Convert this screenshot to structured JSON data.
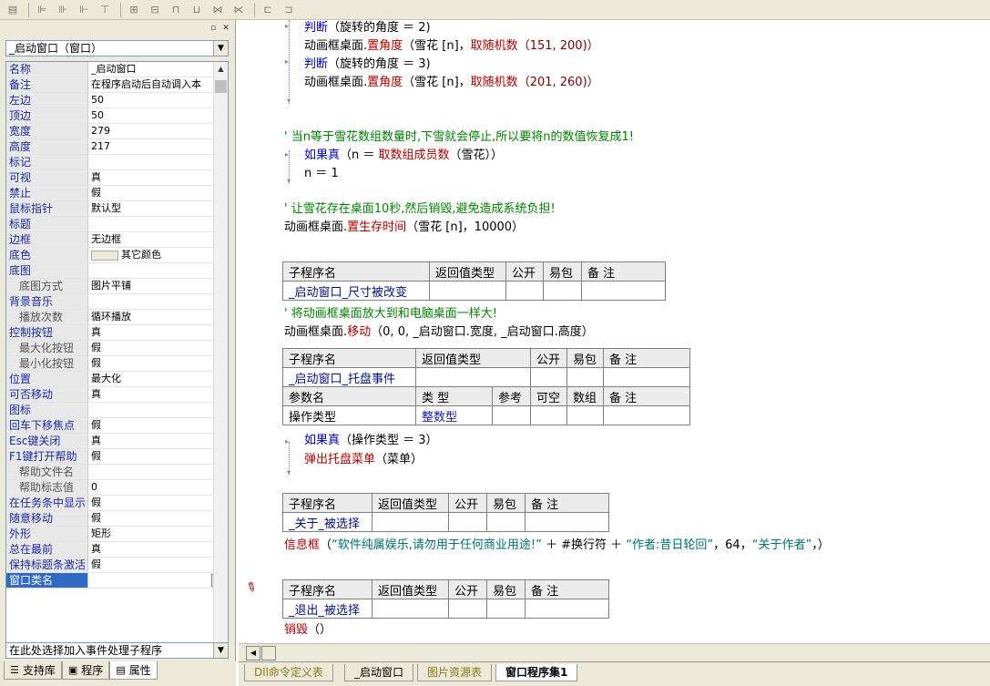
{
  "toolbar": {
    "buttons": [
      "properties-icon",
      "align-left-icon",
      "align-center-icon",
      "align-right-icon",
      "align-top-icon",
      "align-middle-icon",
      "align-bottom-icon",
      "same-width-icon",
      "same-height-icon",
      "same-size-icon",
      "space-h-icon",
      "space-v-icon",
      "center-h-icon",
      "center-v-icon"
    ]
  },
  "left_panel": {
    "object_select": "_启动窗口（窗口）",
    "properties": [
      {
        "name": "名称",
        "value": "_启动窗口"
      },
      {
        "name": "备注",
        "value": "在程序启动后自动调入本"
      },
      {
        "name": "左边",
        "value": "50"
      },
      {
        "name": "顶边",
        "value": "50"
      },
      {
        "name": "宽度",
        "value": "279"
      },
      {
        "name": "高度",
        "value": "217"
      },
      {
        "name": "标记",
        "value": ""
      },
      {
        "name": "可视",
        "value": "真"
      },
      {
        "name": "禁止",
        "value": "假"
      },
      {
        "name": "鼠标指针",
        "value": "默认型"
      },
      {
        "name": "标题",
        "value": ""
      },
      {
        "name": "边框",
        "value": "无边框"
      },
      {
        "name": "底色",
        "value": "其它颜色"
      },
      {
        "name": "底图",
        "value": ""
      },
      {
        "name": "底图方式",
        "value": "图片平铺",
        "sub": true
      },
      {
        "name": "背景音乐",
        "value": ""
      },
      {
        "name": "播放次数",
        "value": "循环播放",
        "sub": true
      },
      {
        "name": "控制按钮",
        "value": "真"
      },
      {
        "name": "最大化按钮",
        "value": "假",
        "sub": true
      },
      {
        "name": "最小化按钮",
        "value": "假",
        "sub": true
      },
      {
        "name": "位置",
        "value": "最大化"
      },
      {
        "name": "可否移动",
        "value": "真"
      },
      {
        "name": "图标",
        "value": ""
      },
      {
        "name": "回车下移焦点",
        "value": "假"
      },
      {
        "name": "Esc键关闭",
        "value": "真"
      },
      {
        "name": "F1键打开帮助",
        "value": "假"
      },
      {
        "name": "帮助文件名",
        "value": "",
        "sub": true
      },
      {
        "name": "帮助标志值",
        "value": "0",
        "sub": true
      },
      {
        "name": "在任务条中显示",
        "value": "假"
      },
      {
        "name": "随意移动",
        "value": "假"
      },
      {
        "name": "外形",
        "value": "矩形"
      },
      {
        "name": "总在最前",
        "value": "真"
      },
      {
        "name": "保持标题条激活",
        "value": "假"
      },
      {
        "name": "窗口类名",
        "value": "",
        "selected": true
      }
    ],
    "event_select": "在此处选择加入事件处理子程序",
    "tabs": [
      {
        "label": "支持库"
      },
      {
        "label": "程序"
      },
      {
        "label": "属性"
      }
    ]
  },
  "code": {
    "l1_kw": "判断",
    "l1_rest": "（旋转的角度 ＝ 2)",
    "l2_obj": "动画框桌面.",
    "l2_fn": "置角度",
    "l2_a": "（雪花 [n]，",
    "l2_fn2": "取随机数",
    "l2_b": "（151, 200)）",
    "l3_kw": "判断",
    "l3_rest": "（旋转的角度 ＝ 3)",
    "l4_obj": "动画框桌面.",
    "l4_fn": "置角度",
    "l4_a": "（雪花 [n]，",
    "l4_fn2": "取随机数",
    "l4_b": "（201, 260)）",
    "c1": "' 当n等于雪花数组数量时,下雪就会停止,所以要将n的数值恢复成1!",
    "if1_kw": "如果真",
    "if1_a": "（n ＝ ",
    "if1_fn": "取数组成员数",
    "if1_b": "（雪花））",
    "assign": "n ＝ 1",
    "c2": "' 让雪花存在桌面10秒,然后销毁,避免造成系统负担!",
    "l5_obj": "动画框桌面.",
    "l5_fn": "置生存时间",
    "l5_a": "（雪花 [n]，10000）",
    "t1": {
      "headers": [
        "子程序名",
        "返回值类型",
        "公开",
        "易包",
        "备 注"
      ],
      "name": "_启动窗口_尺寸被改变"
    },
    "c3": "' 将动画框桌面放大到和电脑桌面一样大!",
    "l6_obj": "动画框桌面.",
    "l6_fn": "移动",
    "l6_a": "（0, 0, _启动窗口.宽度, _启动窗口.高度）",
    "t2": {
      "headers": [
        "子程序名",
        "返回值类型",
        "公开",
        "易包",
        "备 注"
      ],
      "name": "_启动窗口_托盘事件",
      "param_headers": [
        "参数名",
        "类 型",
        "参考",
        "可空",
        "数组",
        "备 注"
      ],
      "param_name": "操作类型",
      "param_type": "整数型"
    },
    "if2_kw": "如果真",
    "if2_rest": "（操作类型 ＝ 3）",
    "popup_fn": "弹出托盘菜单",
    "popup_a": "（菜单）",
    "t3": {
      "headers": [
        "子程序名",
        "返回值类型",
        "公开",
        "易包",
        "备 注"
      ],
      "name": "_关于_被选择"
    },
    "msg_fn": "信息框",
    "msg_a": "（",
    "msg_s1": "“软件纯属娱乐,请勿用于任何商业用途!”",
    "msg_b": " ＋ #换行符 ＋ ",
    "msg_s2": "“作者:昔日轮回”",
    "msg_c": "，64，",
    "msg_s3": "“关于作者”",
    "msg_d": "，）",
    "t4": {
      "headers": [
        "子程序名",
        "返回值类型",
        "公开",
        "易包",
        "备 注"
      ],
      "name": "_退出_被选择"
    },
    "destroy_fn": "销毁",
    "destroy_a": "（）"
  },
  "doc_tabs": [
    "Dll命令定义表",
    "_启动窗口",
    "图片资源表",
    "窗口程序集1"
  ]
}
